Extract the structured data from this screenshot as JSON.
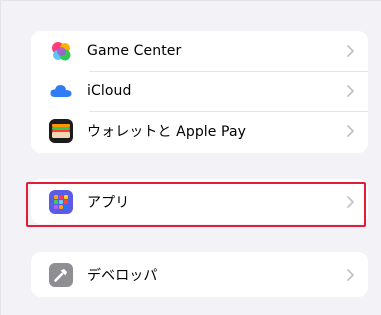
{
  "groups": [
    {
      "items": [
        {
          "label": "Game Center",
          "icon": "game-center-icon"
        },
        {
          "label": "iCloud",
          "icon": "icloud-icon"
        },
        {
          "label": "ウォレットと Apple Pay",
          "icon": "wallet-icon"
        }
      ]
    },
    {
      "items": [
        {
          "label": "アプリ",
          "icon": "apps-icon",
          "highlighted": true
        }
      ]
    },
    {
      "items": [
        {
          "label": "デベロッパ",
          "icon": "developer-hammer-icon"
        }
      ]
    }
  ],
  "colors": {
    "background": "#f2f2f7",
    "highlight": "#e11d3c",
    "chevron": "#c4c4c8",
    "icloud": "#2f7cf6",
    "wallet": "#1c1c1e",
    "apps": "#5b5ce6",
    "developer": "#8e8e93"
  }
}
